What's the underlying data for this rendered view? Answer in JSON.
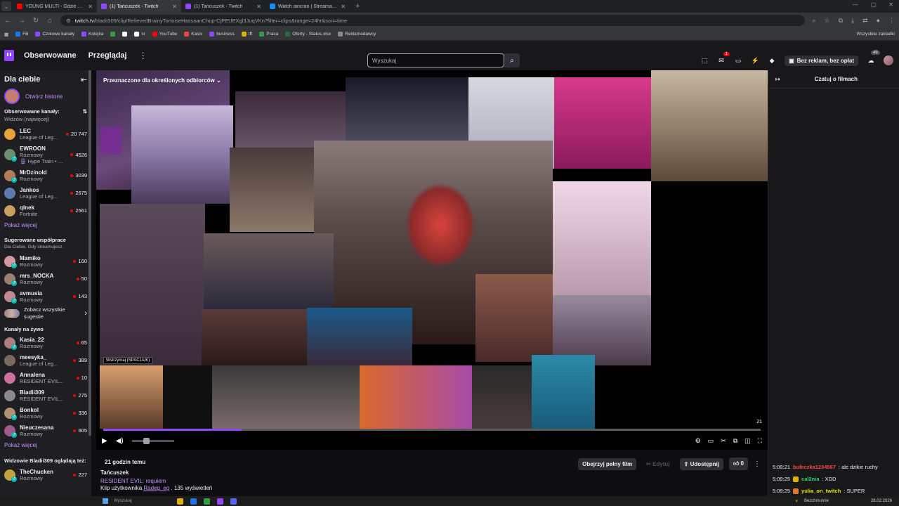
{
  "browser": {
    "tabs": [
      {
        "title": "YOUNG MULTI - Gdzie mój do...",
        "color": "#ff0000",
        "active": false
      },
      {
        "title": "(1) Tańcuszek - Twitch",
        "color": "#9147ff",
        "active": true
      },
      {
        "title": "(1) Tańcuszek - Twitch",
        "color": "#9147ff",
        "active": false
      },
      {
        "title": "Watch iancran | Streamable",
        "color": "#0f90fa",
        "active": false
      }
    ],
    "url_host": "twitch.tv",
    "url_path": "/bladii309/clip/RelievedBrainyTortoiseHassaanChop-CjPEUEXgl3JuqVKn?filter=clips&range=24hr&sort=time",
    "bookmarks": [
      {
        "label": "FB",
        "color": "#1877f2"
      },
      {
        "label": "Czołowe kanały",
        "color": "#9147ff"
      },
      {
        "label": "Kolejka",
        "color": "#9147ff"
      },
      {
        "label": "",
        "color": "#2ea043"
      },
      {
        "label": "",
        "color": "#ffffff"
      },
      {
        "label": "sr",
        "color": "#ffffff"
      },
      {
        "label": "YouTube",
        "color": "#ff0000"
      },
      {
        "label": "Kasix",
        "color": "#e44"
      },
      {
        "label": "business",
        "color": "#9147ff"
      },
      {
        "label": "tft",
        "color": "#e0b000"
      },
      {
        "label": "Praca",
        "color": "#2ea043"
      },
      {
        "label": "Oferty - Status.xlsx",
        "color": "#1d6f42"
      },
      {
        "label": "Reklamodawcy",
        "color": "#888888"
      }
    ],
    "all_bookmarks": "Wszystkie zakładki"
  },
  "topnav": {
    "following": "Obserwowane",
    "browse": "Przeglądaj",
    "search_placeholder": "Wyszukaj",
    "notification_count": "1",
    "no_ads": "Bez reklam, bez opłat",
    "bits_count": "49"
  },
  "sidebar": {
    "title": "Dla ciebie",
    "stories_link": "Otwórz historie",
    "followed_heading": "Obserwowane kanały:",
    "followed_sort": "Widzów (najwięcej)",
    "followed": [
      {
        "name": "LEC",
        "game": "League of Leg...",
        "viewers": "20 747",
        "color": "#e8a33a",
        "rec": false
      },
      {
        "name": "EWROON",
        "game": "Rozmowy",
        "extra": "Hype Train • pozio...",
        "viewers": "4526",
        "color": "#6e8e6e",
        "rec": true
      },
      {
        "name": "MrDzinold",
        "game": "Rozmowy",
        "viewers": "3039",
        "color": "#b47a5a",
        "rec": true
      },
      {
        "name": "Jankos",
        "game": "League of Leg...",
        "viewers": "2675",
        "color": "#5a7ab4",
        "rec": false
      },
      {
        "name": "qlnek",
        "game": "Fortnite",
        "viewers": "2561",
        "color": "#c8a060",
        "rec": false
      }
    ],
    "show_more": "Pokaż więcej",
    "suggested_heading": "Sugerowane współprace",
    "suggested_sub": "Dla Ciebie. Gdy streamujesz.",
    "suggested": [
      {
        "name": "Mamiko",
        "game": "Rozmowy",
        "viewers": "160",
        "color": "#d29aa0",
        "rec": true
      },
      {
        "name": "mrs_NOCKA",
        "game": "Rozmowy",
        "viewers": "50",
        "color": "#9a8070",
        "rec": true
      },
      {
        "name": "avmusia",
        "game": "Rozmowy",
        "viewers": "143",
        "color": "#c08a90",
        "rec": true
      }
    ],
    "see_all": "Zobacz wszystkie sugestie",
    "live_heading": "Kanały na żywo",
    "live": [
      {
        "name": "Kasia_22",
        "game": "Rozmowy",
        "viewers": "65",
        "color": "#b08080",
        "rec": true
      },
      {
        "name": "meesyka_",
        "game": "League of Leg...",
        "viewers": "389",
        "color": "#7a6a5a",
        "rec": false
      },
      {
        "name": "Annalena",
        "game": "RESIDENT EVIL...",
        "viewers": "10",
        "color": "#d070a0",
        "rec": false
      },
      {
        "name": "Bladii309",
        "game": "RESIDENT EVIL...",
        "viewers": "275",
        "color": "#8a8a8a",
        "rec": false
      },
      {
        "name": "Bonkol",
        "game": "Rozmowy",
        "viewers": "336",
        "color": "#b09070",
        "rec": true
      },
      {
        "name": "Nieuczesana",
        "game": "Rozmowy",
        "viewers": "605",
        "color": "#a05a8a",
        "rec": true
      }
    ],
    "show_more_2": "Pokaż więcej",
    "also_watch_heading": "Widzowie Bladii309 oglądają też:",
    "also_watch": [
      {
        "name": "TheChucken",
        "game": "Rozmowy",
        "viewers": "227",
        "color": "#c0a040",
        "rec": true
      }
    ]
  },
  "player": {
    "audience_label": "Przeznaczone dla określonych odbiorców",
    "progress": 0.21,
    "time": "21",
    "tooltip": "Wstrzymaj (SPACJA/K)"
  },
  "clip": {
    "age": "21 godzin temu",
    "channel": "Tańcuszek",
    "category": "RESIDENT EVIL: requiem",
    "meta_prefix": "Klip użytkownika",
    "author": "Radeg_eg",
    "views": ". 135 wyświetleń",
    "watch_full": "Obejrzyj pełny film",
    "edit": "Edytuj",
    "share": "Udostępnij",
    "likes": "0"
  },
  "chat": {
    "header": "Czatuj o filmach",
    "messages": [
      {
        "time": "5:09:21",
        "user": "bułeczka1234567",
        "color": "#ff4545",
        "text": ": ale dzikie ruchy"
      },
      {
        "time": "5:09:25",
        "user": "cal2nia",
        "color": "#2ecc71",
        "text": ": XDD"
      },
      {
        "time": "5:09:25",
        "user": "yulia_on_twitch",
        "color": "#e6e600",
        "text": ": SUPER"
      }
    ]
  },
  "taskbar": {
    "search": "Wyszukaj",
    "weather": "Bezchmurnie",
    "date": "28.02.2026"
  }
}
